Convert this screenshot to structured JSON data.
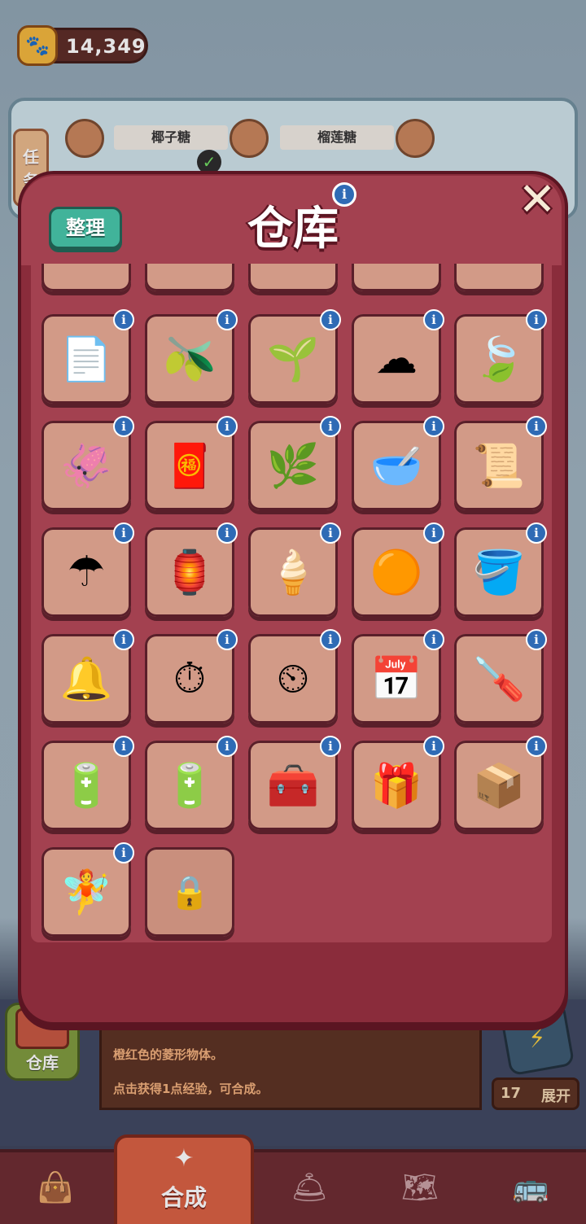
{
  "hud": {
    "coins": "14,349",
    "paw_icon": "paw-icon"
  },
  "tasks": {
    "side_label_1": "任",
    "side_label_2": "务",
    "items": [
      {
        "name": "椰子糖"
      },
      {
        "name": "榴莲糖"
      }
    ]
  },
  "modal": {
    "title": "仓库",
    "sort_label": "整理",
    "close_icon": "close-icon",
    "info_glyph": "i"
  },
  "inventory": [
    {
      "name": "paper-stack"
    },
    {
      "name": "green-seed"
    },
    {
      "name": "tea-sprout"
    },
    {
      "name": "white-cotton"
    },
    {
      "name": "tea-leaves-tray"
    },
    {
      "name": "dried-squid"
    },
    {
      "name": "red-packet-box"
    },
    {
      "name": "dried-tea-mat"
    },
    {
      "name": "tea-bowl"
    },
    {
      "name": "tea-scroll"
    },
    {
      "name": "paper-umbrella"
    },
    {
      "name": "red-sedan-chair"
    },
    {
      "name": "cornucopia"
    },
    {
      "name": "orange-ball"
    },
    {
      "name": "wooden-bucket"
    },
    {
      "name": "incense-burner"
    },
    {
      "name": "stopwatch-small"
    },
    {
      "name": "stopwatch-large"
    },
    {
      "name": "calendar"
    },
    {
      "name": "screwdriver"
    },
    {
      "name": "green-battery"
    },
    {
      "name": "yellow-battery"
    },
    {
      "name": "orange-chest"
    },
    {
      "name": "red-chest"
    },
    {
      "name": "jack-in-box"
    },
    {
      "name": "fairy-figurine"
    }
  ],
  "locked_slot": {
    "name": "lock-icon"
  },
  "description": {
    "line1": "橙红色的菱形物体。",
    "line2": "点击获得1点经验，可合成。"
  },
  "warehouse_button": {
    "label": "仓库"
  },
  "expand": {
    "count": "17",
    "label": "展开"
  },
  "nav": {
    "items": [
      "shop-bag-icon",
      "merge-icon",
      "service-bell-icon",
      "map-icon",
      "bus-icon"
    ],
    "active_label": "合成"
  },
  "colors": {
    "modal": "#8a2c3b",
    "slot": "#d29a87",
    "sort_button": "#41b39a",
    "info_badge": "#2f6bb5"
  }
}
